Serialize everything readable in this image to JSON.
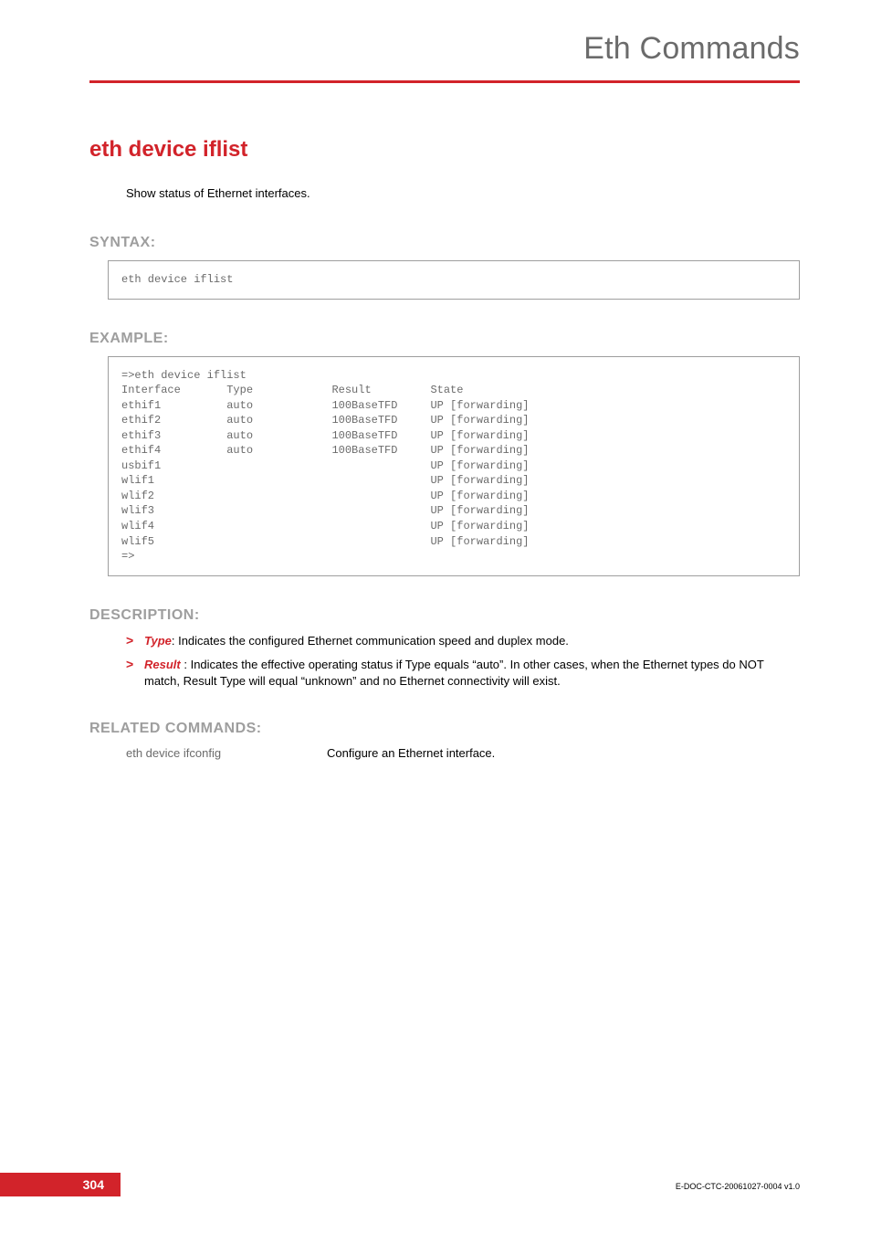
{
  "header": {
    "title": "Eth Commands"
  },
  "command": {
    "title": "eth device iflist",
    "intro": "Show status of Ethernet interfaces."
  },
  "syntax": {
    "heading": "SYNTAX:",
    "code": "eth device iflist"
  },
  "example": {
    "heading": "EXAMPLE:",
    "code": "=>eth device iflist\nInterface       Type            Result         State\nethif1          auto            100BaseTFD     UP [forwarding]\nethif2          auto            100BaseTFD     UP [forwarding]\nethif3          auto            100BaseTFD     UP [forwarding]\nethif4          auto            100BaseTFD     UP [forwarding]\nusbif1                                         UP [forwarding]\nwlif1                                          UP [forwarding]\nwlif2                                          UP [forwarding]\nwlif3                                          UP [forwarding]\nwlif4                                          UP [forwarding]\nwlif5                                          UP [forwarding]\n=>"
  },
  "description": {
    "heading": "DESCRIPTION:",
    "items": [
      {
        "term": "Type",
        "sep": ": ",
        "text": "Indicates the configured Ethernet communication speed and duplex mode."
      },
      {
        "term": "Result",
        "sep": " : ",
        "text": "Indicates the effective operating status if Type equals “auto”. In other cases, when the Ethernet types do NOT match, Result Type will equal “unknown” and no Ethernet connectivity will exist."
      }
    ]
  },
  "related": {
    "heading": "RELATED COMMANDS:",
    "rows": [
      {
        "cmd": "eth device ifconfig",
        "desc": "Configure an Ethernet interface."
      }
    ]
  },
  "footer": {
    "page": "304",
    "docid": "E-DOC-CTC-20061027-0004 v1.0"
  },
  "chart_data": {
    "type": "table",
    "title": "eth device iflist output",
    "columns": [
      "Interface",
      "Type",
      "Result",
      "State"
    ],
    "rows": [
      [
        "ethif1",
        "auto",
        "100BaseTFD",
        "UP [forwarding]"
      ],
      [
        "ethif2",
        "auto",
        "100BaseTFD",
        "UP [forwarding]"
      ],
      [
        "ethif3",
        "auto",
        "100BaseTFD",
        "UP [forwarding]"
      ],
      [
        "ethif4",
        "auto",
        "100BaseTFD",
        "UP [forwarding]"
      ],
      [
        "usbif1",
        "",
        "",
        "UP [forwarding]"
      ],
      [
        "wlif1",
        "",
        "",
        "UP [forwarding]"
      ],
      [
        "wlif2",
        "",
        "",
        "UP [forwarding]"
      ],
      [
        "wlif3",
        "",
        "",
        "UP [forwarding]"
      ],
      [
        "wlif4",
        "",
        "",
        "UP [forwarding]"
      ],
      [
        "wlif5",
        "",
        "",
        "UP [forwarding]"
      ]
    ]
  }
}
